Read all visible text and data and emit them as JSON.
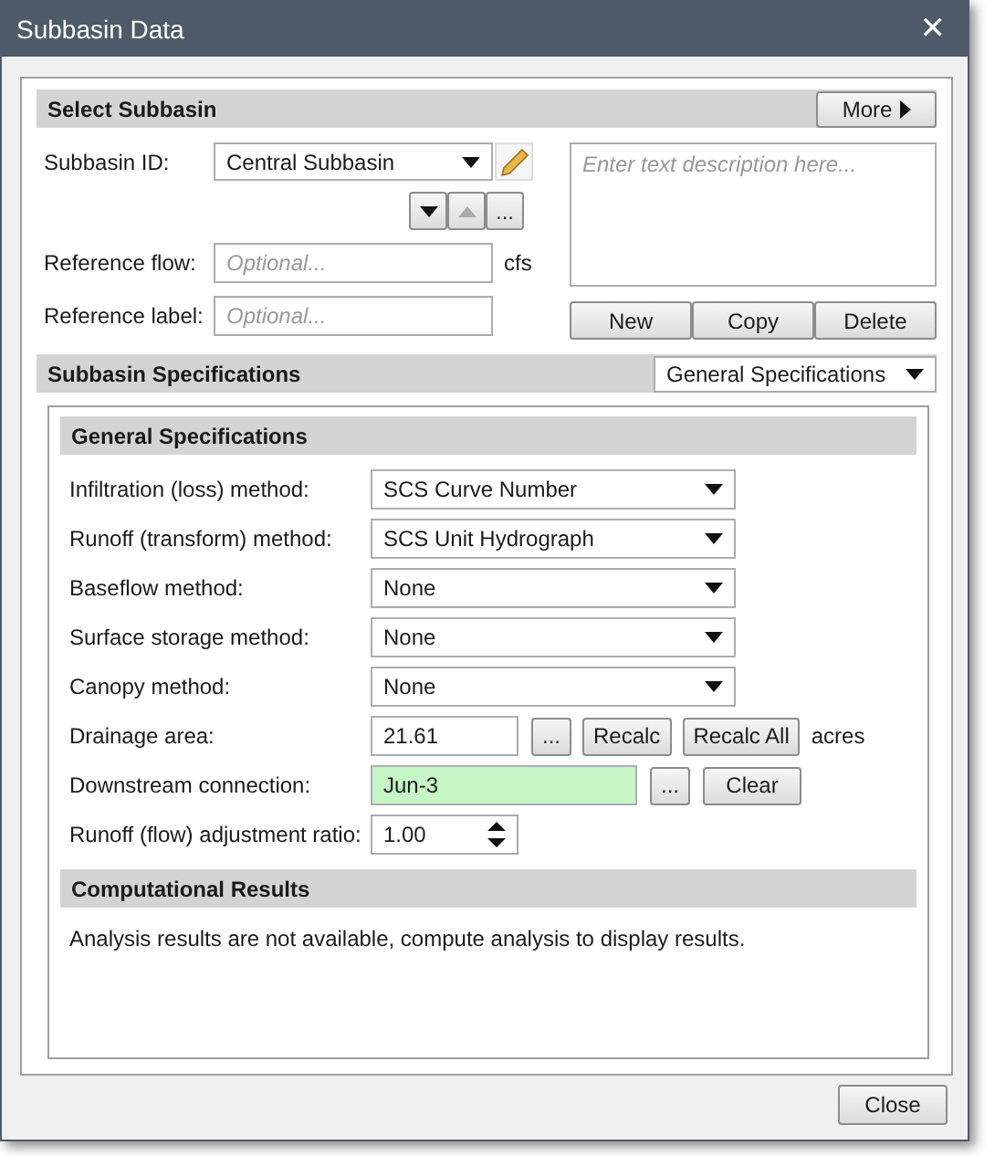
{
  "window": {
    "title": "Subbasin Data",
    "close": "✕"
  },
  "select_section": {
    "title": "Select Subbasin",
    "more_button": "More",
    "subbasin_id": {
      "label": "Subbasin ID:",
      "value": "Central Subbasin"
    },
    "nav_buttons": [
      {
        "kind": "down",
        "disabled": false
      },
      {
        "kind": "up",
        "disabled": true
      },
      {
        "kind": "browse",
        "label": "...",
        "disabled": false
      }
    ],
    "reference_flow": {
      "label": "Reference flow:",
      "placeholder": "Optional...",
      "unit": "cfs"
    },
    "reference_label": {
      "label": "Reference label:",
      "placeholder": "Optional..."
    },
    "description": {
      "placeholder": "Enter text description here..."
    },
    "buttons": [
      "New",
      "Copy",
      "Delete"
    ]
  },
  "specs_section": {
    "title": "Subbasin Specifications",
    "view": "General Specifications",
    "general": {
      "title": "General Specifications",
      "rows": [
        {
          "kind": "dropdown",
          "label": "Infiltration (loss) method:",
          "value": "SCS Curve Number"
        },
        {
          "kind": "dropdown",
          "label": "Runoff (transform) method:",
          "value": "SCS Unit Hydrograph"
        },
        {
          "kind": "dropdown",
          "label": "Baseflow method:",
          "value": "None"
        },
        {
          "kind": "dropdown",
          "label": "Surface storage method:",
          "value": "None"
        },
        {
          "kind": "dropdown",
          "label": "Canopy method:",
          "value": "None"
        },
        {
          "kind": "area",
          "label": "Drainage area:",
          "value": "21.61",
          "buttons": [
            "...",
            "Recalc",
            "Recalc All"
          ],
          "unit": "acres"
        },
        {
          "kind": "connection",
          "label": "Downstream connection:",
          "value": "Jun-3",
          "buttons": [
            "...",
            "Clear"
          ]
        },
        {
          "kind": "spinner",
          "label": "Runoff (flow) adjustment ratio:",
          "value": "1.00"
        }
      ]
    },
    "results": {
      "title": "Computational Results",
      "message": "Analysis results are not available, compute analysis to display results."
    }
  },
  "footer": {
    "close_button": "Close"
  }
}
